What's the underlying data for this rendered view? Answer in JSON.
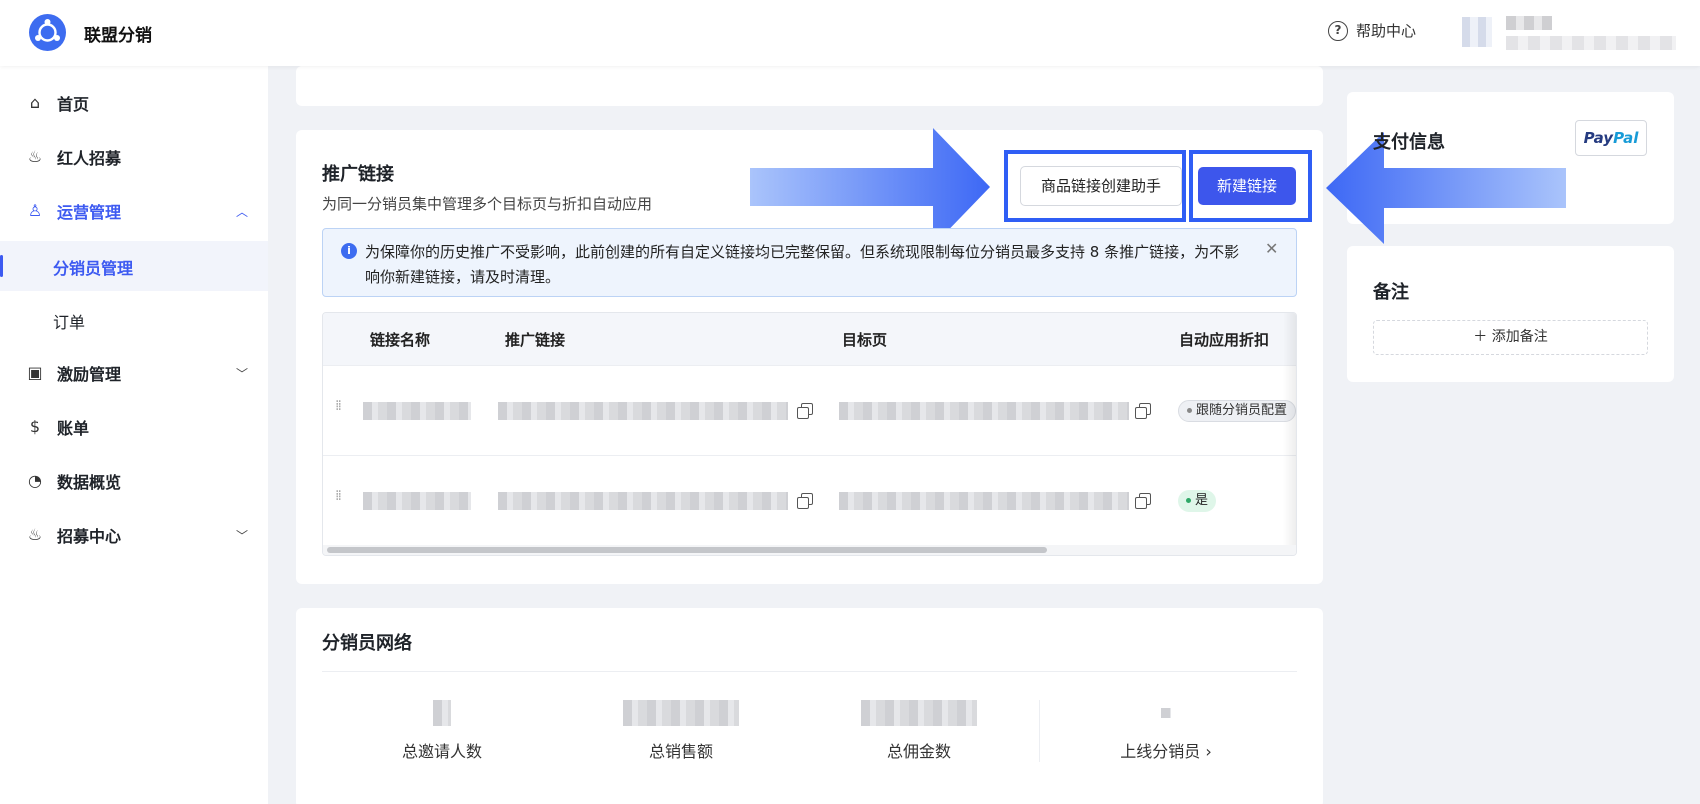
{
  "app": {
    "title": "联盟分销"
  },
  "header": {
    "help_label": "帮助中心",
    "help_icon": "question-circle-icon"
  },
  "sidebar": {
    "items": [
      {
        "label": "首页",
        "icon": "home-icon"
      },
      {
        "label": "红人招募",
        "icon": "fire-icon"
      },
      {
        "label": "运营管理",
        "icon": "user-icon"
      },
      {
        "label": "分销员管理"
      },
      {
        "label": "订单"
      },
      {
        "label": "激励管理",
        "icon": "wallet-icon"
      },
      {
        "label": "账单",
        "icon": "bill-icon"
      },
      {
        "label": "数据概览",
        "icon": "pie-chart-icon"
      },
      {
        "label": "招募中心",
        "icon": "fire-icon"
      }
    ]
  },
  "links_section": {
    "title": "推广链接",
    "subtitle": "为同一分销员集中管理多个目标页与折扣自动应用",
    "helper_button": "商品链接创建助手",
    "new_button": "新建链接",
    "alert_text": "为保障你的历史推广不受影响，此前创建的所有自定义链接均已完整保留。但系统现限制每位分销员最多支持 8 条推广链接，为不影响你新建链接，请及时清理。",
    "table": {
      "columns": [
        "链接名称",
        "推广链接",
        "目标页",
        "自动应用折扣"
      ],
      "rows": [
        {
          "discount": "跟随分销员配置"
        },
        {
          "discount": "是"
        }
      ]
    }
  },
  "network_section": {
    "title": "分销员网络",
    "stats": [
      {
        "label": "总邀请人数"
      },
      {
        "label": "总销售额"
      },
      {
        "label": "总佣金数"
      },
      {
        "label": "上线分销员 ›"
      }
    ]
  },
  "payment_section": {
    "title": "支付信息",
    "paypal_a": "Pay",
    "paypal_b": "Pal"
  },
  "note_section": {
    "title": "备注",
    "add_button": "＋  添加备注"
  },
  "colors": {
    "accent": "#3d56ec",
    "highlight": "#2f5ef5",
    "alert_bg": "#eef4fd"
  }
}
